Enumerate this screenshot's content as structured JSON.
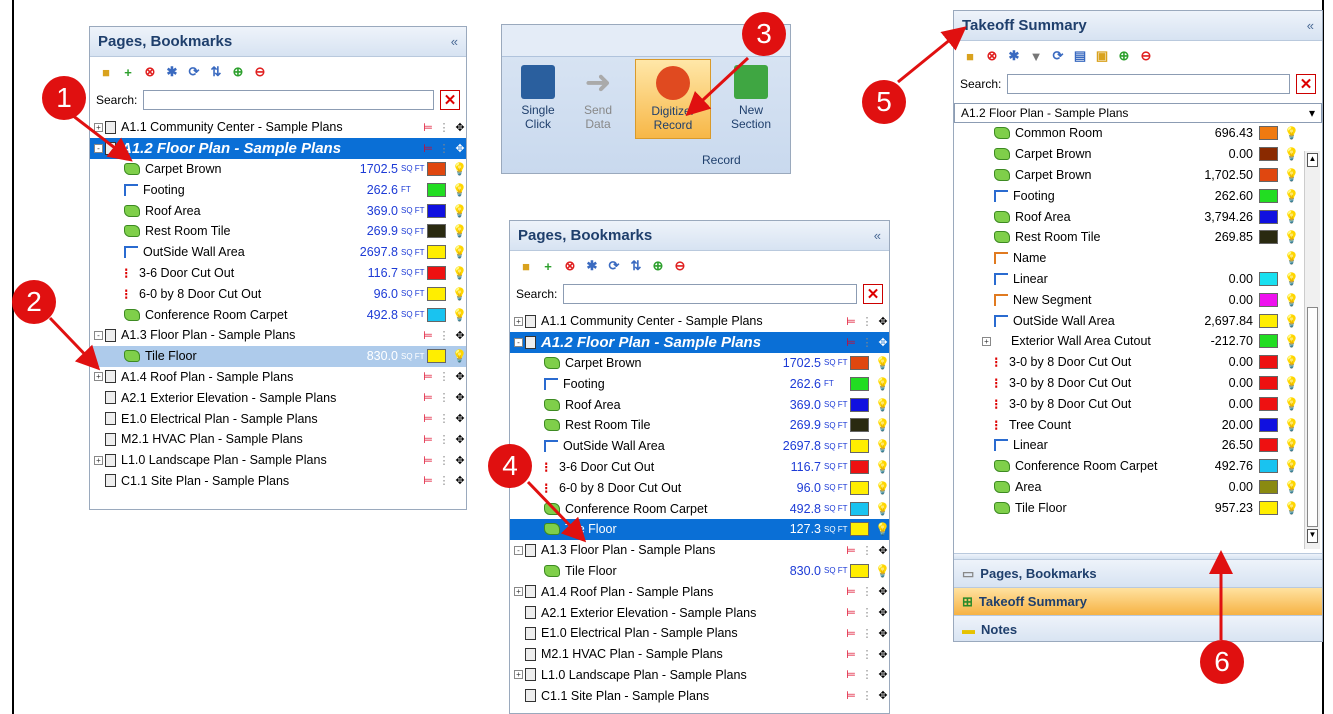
{
  "panel1": {
    "title": "Pages, Bookmarks",
    "search_label": "Search:",
    "rows": [
      {
        "kind": "page",
        "title": "A1.1 Community Center - Sample Plans",
        "exp": "+"
      },
      {
        "kind": "page",
        "title": "A1.2 Floor Plan - Sample Plans",
        "exp": "-",
        "big": true
      },
      {
        "kind": "item",
        "icon": "area",
        "name": "Carpet Brown",
        "value": "1702.5",
        "unit": "SQ FT",
        "color": "#e0470f"
      },
      {
        "kind": "item",
        "icon": "linear",
        "name": "Footing",
        "value": "262.6",
        "unit": "FT",
        "color": "#22dd22"
      },
      {
        "kind": "item",
        "icon": "area",
        "name": "Roof Area",
        "value": "369.0",
        "unit": "SQ FT",
        "color": "#1010e0"
      },
      {
        "kind": "item",
        "icon": "area",
        "name": "Rest Room Tile",
        "value": "269.9",
        "unit": "SQ FT",
        "color": "#2a2a10"
      },
      {
        "kind": "item",
        "icon": "linear",
        "name": "OutSide Wall Area",
        "value": "2697.8",
        "unit": "SQ FT",
        "color": "#ffee00"
      },
      {
        "kind": "item",
        "icon": "count",
        "name": "3-6 Door Cut Out",
        "value": "116.7",
        "unit": "SQ FT",
        "color": "#ee1111"
      },
      {
        "kind": "item",
        "icon": "count",
        "name": "6-0 by 8 Door Cut Out",
        "value": "96.0",
        "unit": "SQ FT",
        "color": "#ffee00"
      },
      {
        "kind": "item",
        "icon": "area",
        "name": "Conference Room Carpet",
        "value": "492.8",
        "unit": "SQ FT",
        "color": "#19c3f0"
      },
      {
        "kind": "page",
        "title": "A1.3 Floor Plan - Sample Plans",
        "exp": "-"
      },
      {
        "kind": "item",
        "icon": "area",
        "name": "Tile Floor",
        "value": "830.0",
        "unit": "SQ FT",
        "color": "#ffee00",
        "hl": true
      },
      {
        "kind": "page",
        "title": "A1.4 Roof Plan - Sample Plans",
        "exp": "+"
      },
      {
        "kind": "page",
        "title": "A2.1 Exterior Elevation - Sample Plans",
        "exp": ""
      },
      {
        "kind": "page",
        "title": "E1.0 Electrical Plan - Sample Plans",
        "exp": ""
      },
      {
        "kind": "page",
        "title": "M2.1 HVAC Plan - Sample Plans",
        "exp": ""
      },
      {
        "kind": "page",
        "title": "L1.0 Landscape Plan - Sample Plans",
        "exp": "+"
      },
      {
        "kind": "page",
        "title": "C1.1 Site Plan - Sample Plans",
        "exp": ""
      }
    ]
  },
  "ribbon": {
    "buttons": [
      {
        "label1": "Single",
        "label2": "Click"
      },
      {
        "label1": "Send",
        "label2": "Data"
      },
      {
        "label1": "Digitizer",
        "label2": "Record"
      },
      {
        "label1": "New",
        "label2": "Section"
      }
    ],
    "group_label": "Record"
  },
  "panel2": {
    "title": "Pages, Bookmarks",
    "search_label": "Search:",
    "rows": [
      {
        "kind": "page",
        "title": "A1.1 Community Center - Sample Plans",
        "exp": "+"
      },
      {
        "kind": "page",
        "title": "A1.2 Floor Plan - Sample Plans",
        "exp": "-",
        "big": true
      },
      {
        "kind": "item",
        "icon": "area",
        "name": "Carpet Brown",
        "value": "1702.5",
        "unit": "SQ FT",
        "color": "#e0470f"
      },
      {
        "kind": "item",
        "icon": "linear",
        "name": "Footing",
        "value": "262.6",
        "unit": "FT",
        "color": "#22dd22"
      },
      {
        "kind": "item",
        "icon": "area",
        "name": "Roof Area",
        "value": "369.0",
        "unit": "SQ FT",
        "color": "#1010e0"
      },
      {
        "kind": "item",
        "icon": "area",
        "name": "Rest Room Tile",
        "value": "269.9",
        "unit": "SQ FT",
        "color": "#2a2a10"
      },
      {
        "kind": "item",
        "icon": "linear",
        "name": "OutSide Wall Area",
        "value": "2697.8",
        "unit": "SQ FT",
        "color": "#ffee00"
      },
      {
        "kind": "item",
        "icon": "count",
        "name": "3-6 Door Cut Out",
        "value": "116.7",
        "unit": "SQ FT",
        "color": "#ee1111"
      },
      {
        "kind": "item",
        "icon": "count",
        "name": "6-0 by 8 Door Cut Out",
        "value": "96.0",
        "unit": "SQ FT",
        "color": "#ffee00"
      },
      {
        "kind": "item",
        "icon": "area",
        "name": "Conference Room Carpet",
        "value": "492.8",
        "unit": "SQ FT",
        "color": "#19c3f0"
      },
      {
        "kind": "item",
        "icon": "area",
        "name": "Tile Floor",
        "value": "127.3",
        "unit": "SQ FT",
        "color": "#ffee00",
        "sel": true
      },
      {
        "kind": "page",
        "title": "A1.3 Floor Plan - Sample Plans",
        "exp": "-"
      },
      {
        "kind": "item",
        "icon": "area",
        "name": "Tile Floor",
        "value": "830.0",
        "unit": "SQ FT",
        "color": "#ffee00"
      },
      {
        "kind": "page",
        "title": "A1.4 Roof Plan - Sample Plans",
        "exp": "+"
      },
      {
        "kind": "page",
        "title": "A2.1 Exterior Elevation - Sample Plans",
        "exp": ""
      },
      {
        "kind": "page",
        "title": "E1.0 Electrical Plan - Sample Plans",
        "exp": ""
      },
      {
        "kind": "page",
        "title": "M2.1 HVAC Plan - Sample Plans",
        "exp": ""
      },
      {
        "kind": "page",
        "title": "L1.0 Landscape Plan - Sample Plans",
        "exp": "+"
      },
      {
        "kind": "page",
        "title": "C1.1 Site Plan - Sample Plans",
        "exp": ""
      }
    ]
  },
  "takeoff": {
    "title": "Takeoff Summary",
    "search_label": "Search:",
    "dropdown": "A1.2 Floor Plan - Sample Plans",
    "rows": [
      {
        "icon": "area",
        "name": "Common Room",
        "value": "696.43",
        "color": "#f07a10"
      },
      {
        "icon": "area",
        "name": "Carpet Brown",
        "value": "0.00",
        "color": "#8a2a00"
      },
      {
        "icon": "area",
        "name": "Carpet Brown",
        "value": "1,702.50",
        "color": "#e0470f"
      },
      {
        "icon": "linear",
        "name": "Footing",
        "value": "262.60",
        "color": "#22dd22"
      },
      {
        "icon": "area",
        "name": "Roof Area",
        "value": "3,794.26",
        "color": "#1010e0"
      },
      {
        "icon": "area",
        "name": "Rest Room Tile",
        "value": "269.85",
        "color": "#2a2a10"
      },
      {
        "icon": "seg",
        "name": "Name",
        "value": "",
        "color": ""
      },
      {
        "icon": "linear",
        "name": "Linear",
        "value": "0.00",
        "color": "#19e0f0"
      },
      {
        "icon": "seg",
        "name": "New Segment",
        "value": "0.00",
        "color": "#ee11ee"
      },
      {
        "icon": "linear",
        "name": "OutSide Wall Area",
        "value": "2,697.84",
        "color": "#ffee00"
      },
      {
        "icon": "plus",
        "name": "Exterior Wall Area Cutout",
        "value": "-212.70",
        "color": "#22dd22"
      },
      {
        "icon": "count",
        "name": "3-0 by 8 Door Cut Out",
        "value": "0.00",
        "color": "#ee1111"
      },
      {
        "icon": "count",
        "name": "3-0 by 8 Door Cut Out",
        "value": "0.00",
        "color": "#ee1111"
      },
      {
        "icon": "count",
        "name": "3-0 by 8 Door Cut Out",
        "value": "0.00",
        "color": "#ee1111"
      },
      {
        "icon": "count",
        "name": "Tree Count",
        "value": "20.00",
        "color": "#1010e0"
      },
      {
        "icon": "linear",
        "name": "Linear",
        "value": "26.50",
        "color": "#ee1111",
        "on": true
      },
      {
        "icon": "area",
        "name": "Conference Room Carpet",
        "value": "492.76",
        "color": "#19c3f0"
      },
      {
        "icon": "area",
        "name": "Area",
        "value": "0.00",
        "color": "#8a8a10"
      },
      {
        "icon": "area",
        "name": "Tile Floor",
        "value": "957.23",
        "color": "#ffee00",
        "on": true
      }
    ],
    "nav": [
      {
        "label": "Pages, Bookmarks"
      },
      {
        "label": "Takeoff Summary",
        "active": true
      },
      {
        "label": "Notes"
      }
    ]
  },
  "callouts": [
    "1",
    "2",
    "3",
    "4",
    "5",
    "6"
  ],
  "colors": {
    "callout": "#e01010",
    "selected": "#0a6fd6",
    "accent": "#1f3f6c"
  }
}
